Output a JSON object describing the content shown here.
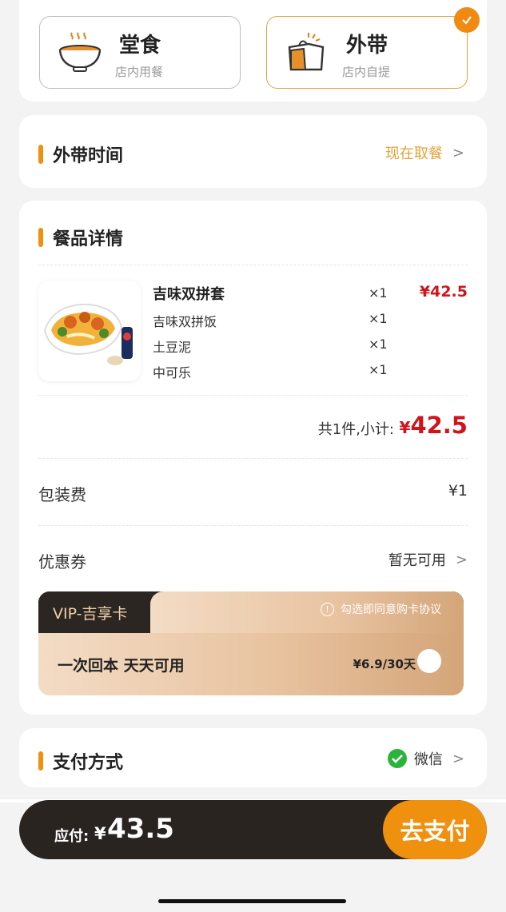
{
  "mode": {
    "dine_in": {
      "title": "堂食",
      "subtitle": "店内用餐"
    },
    "takeout": {
      "title": "外带",
      "subtitle": "店内自提",
      "selected": true
    }
  },
  "pickup": {
    "title": "外带时间",
    "value": "现在取餐"
  },
  "details": {
    "title": "餐品详情",
    "product": {
      "name": "吉味双拼套",
      "qty": "×1",
      "price": "¥42.5",
      "items": [
        {
          "name": "吉味双拼饭",
          "qty": "×1"
        },
        {
          "name": "土豆泥",
          "qty": "×1"
        },
        {
          "name": "中可乐",
          "qty": "×1"
        }
      ]
    },
    "subtotal_label": "共1件,小计:",
    "subtotal_currency": "¥",
    "subtotal_value": "42.5",
    "packaging_label": "包装费",
    "packaging_value": "¥1",
    "coupon_label": "优惠券",
    "coupon_value": "暂无可用"
  },
  "vip": {
    "tab": "VIP-吉享卡",
    "agree": "勾选即同意购卡协议",
    "slogan": "一次回本 天天可用",
    "price": "¥6.9/30天"
  },
  "payment": {
    "title": "支付方式",
    "method": "微信"
  },
  "bottom": {
    "label": "应付:",
    "currency": "¥",
    "amount": "43.5",
    "button": "去支付"
  },
  "colors": {
    "accent": "#f0900f",
    "price_red": "#d0141d",
    "dark": "#2a2421"
  }
}
